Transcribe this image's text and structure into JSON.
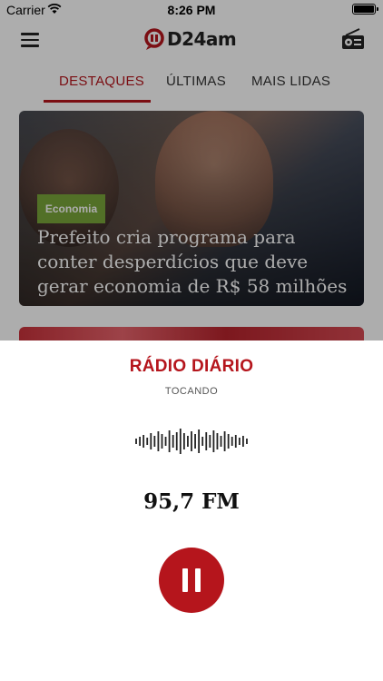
{
  "status_bar": {
    "carrier": "Carrier",
    "time": "8:26 PM",
    "wifi_icon": "wifi-icon",
    "battery_icon": "battery-icon"
  },
  "nav_bar": {
    "menu_icon": "menu-icon",
    "logo_text": "D24am",
    "radio_icon": "radio-icon"
  },
  "tabs": [
    {
      "label": "DESTAQUES",
      "active": true
    },
    {
      "label": "ÚLTIMAS",
      "active": false
    },
    {
      "label": "MAIS LIDAS",
      "active": false
    }
  ],
  "featured": {
    "category": "Economia",
    "title": "Prefeito cria programa para conter desperdícios que deve gerar economia de R$ 58 milhões"
  },
  "player": {
    "station": "RÁDIO DIÁRIO",
    "status": "TOCANDO",
    "frequency": "95,7 FM",
    "waveform_icon": "waveform-icon",
    "pause_icon": "pause-icon"
  },
  "colors": {
    "accent": "#b5151c",
    "category_badge": "#7aa53a"
  }
}
